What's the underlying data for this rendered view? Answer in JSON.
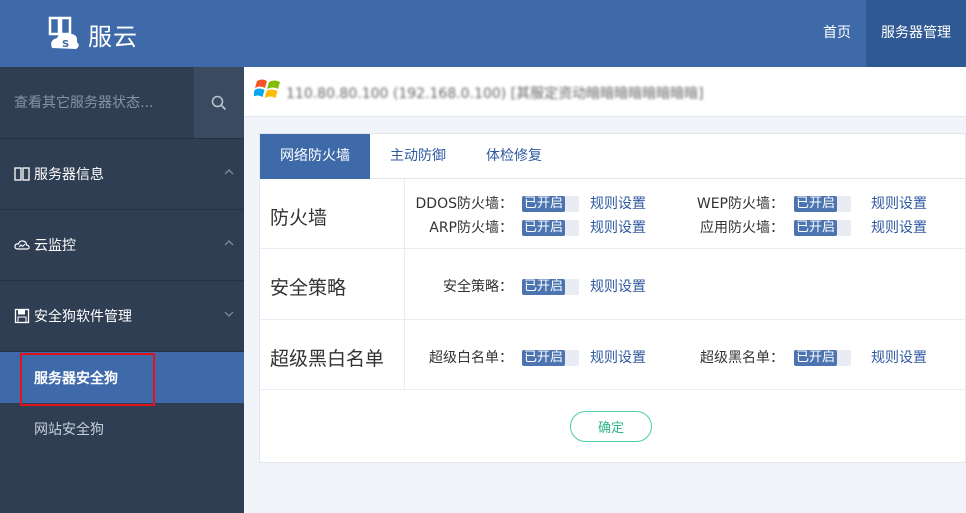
{
  "header": {
    "brand": "服云",
    "nav": [
      {
        "label": "首页",
        "active": false
      },
      {
        "label": "服务器管理",
        "active": true
      }
    ]
  },
  "sidebar": {
    "search_placeholder": "查看其它服务器状态...",
    "items": [
      {
        "label": "服务器信息",
        "icon": "columns-icon",
        "chevron": "up"
      },
      {
        "label": "云监控",
        "icon": "cloud-icon",
        "chevron": "up"
      },
      {
        "label": "安全狗软件管理",
        "icon": "save-icon",
        "chevron": "down"
      }
    ],
    "subitems": [
      {
        "label": "服务器安全狗",
        "active": true
      },
      {
        "label": "网站安全狗",
        "active": false
      }
    ],
    "highlight_color": "#e0131c"
  },
  "content": {
    "server_title": "110.80.80.100 (192.168.0.100) [其服定资动暗暗暗暗暗暗暗暗]",
    "tabs": [
      {
        "label": "网络防火墙",
        "active": true
      },
      {
        "label": "主动防御",
        "active": false
      },
      {
        "label": "体检修复",
        "active": false
      }
    ],
    "sections": [
      {
        "title": "防火墙",
        "fields": [
          {
            "label": "DDOS防火墙：",
            "status": "已开启",
            "link": "规则设置"
          },
          {
            "label": "WEP防火墙：",
            "status": "已开启",
            "link": "规则设置"
          },
          {
            "label": "ARP防火墙：",
            "status": "已开启",
            "link": "规则设置"
          },
          {
            "label": "应用防火墙：",
            "status": "已开启",
            "link": "规则设置"
          }
        ]
      },
      {
        "title": "安全策略",
        "fields": [
          {
            "label": "安全策略：",
            "status": "已开启",
            "link": "规则设置"
          }
        ]
      },
      {
        "title": "超级黑白名单",
        "fields": [
          {
            "label": "超级白名单：",
            "status": "已开启",
            "link": "规则设置"
          },
          {
            "label": "超级黑名单：",
            "status": "已开启",
            "link": "规则设置"
          }
        ]
      }
    ],
    "confirm_label": "确定"
  },
  "colors": {
    "header": "#3e6aaa",
    "sidebar": "#2f3e52",
    "accent": "#3e6aaa",
    "confirm": "#2fb886"
  }
}
